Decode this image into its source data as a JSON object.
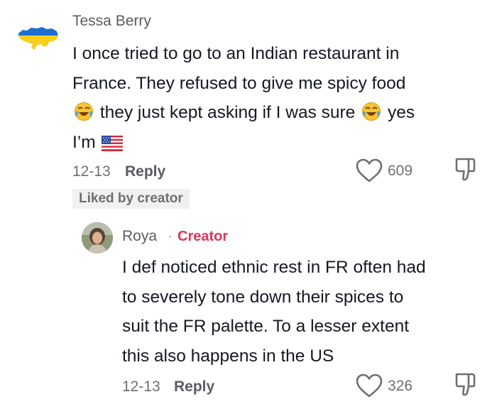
{
  "comment": {
    "username": "Tessa Berry",
    "avatar_icon": "ukraine-map-flag-icon",
    "text_line1": "I once tried to go to an Indian restaurant in",
    "text_line2": "France. They refused to give me spicy food",
    "text_line3_a": "they just kept asking if I was sure",
    "text_line3_b": "yes",
    "text_line4": "I’m",
    "emoji_laugh": "face-with-tears-of-joy-icon",
    "emoji_flag": "us-flag-icon",
    "date": "12-13",
    "reply_label": "Reply",
    "like_count": "609",
    "liked_badge": "Liked by creator"
  },
  "reply": {
    "username": "Roya",
    "separator": "·",
    "creator_label": "Creator",
    "text_line1": "I def noticed ethnic rest in FR often had",
    "text_line2": "to severely tone down their spices to",
    "text_line3": "suit the FR palette. To a lesser extent",
    "text_line4": "this also happens in the US",
    "date": "12-13",
    "reply_label": "Reply",
    "like_count": "326"
  },
  "colors": {
    "creator_accent": "#e2345a",
    "secondary_text": "#6e6f74",
    "badge_bg": "#f1f1f2"
  }
}
